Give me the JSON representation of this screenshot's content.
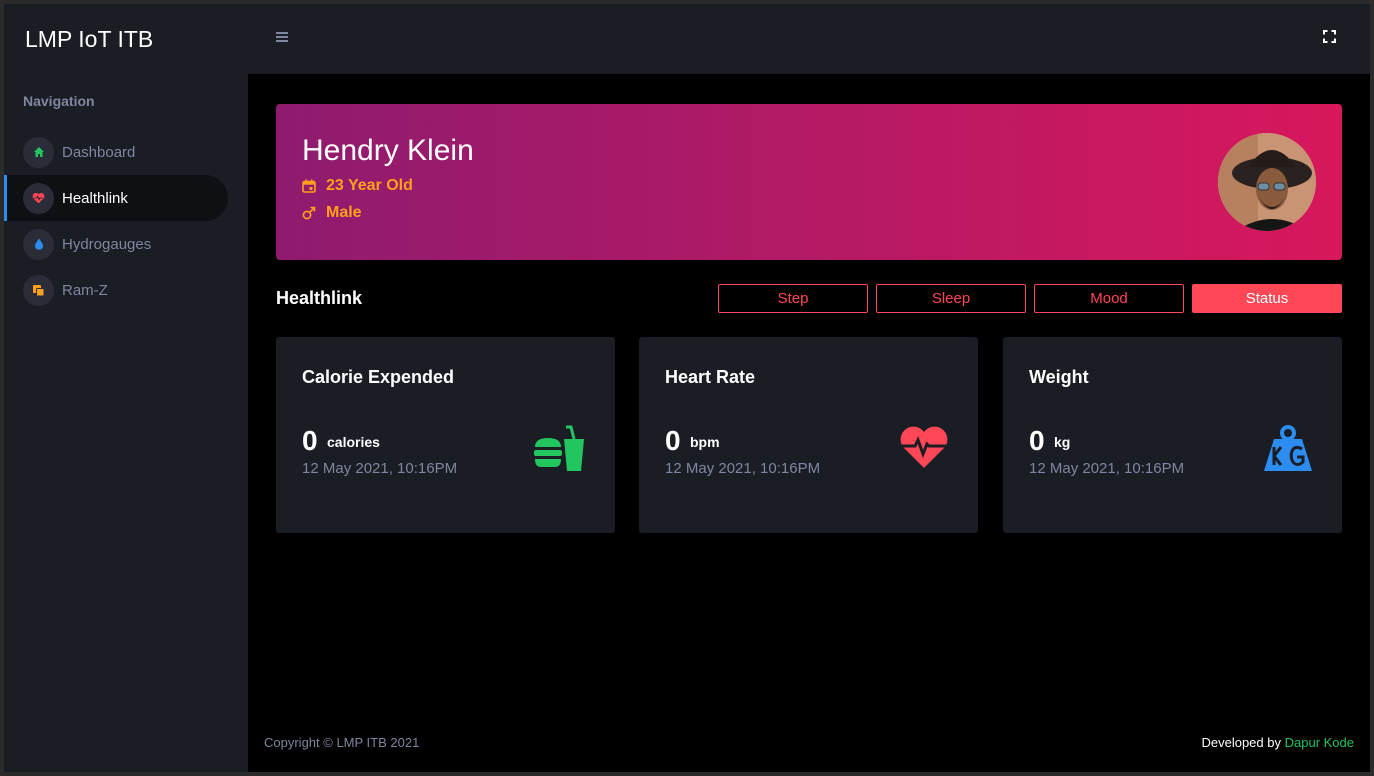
{
  "app": {
    "title": "LMP IoT ITB"
  },
  "sidebar": {
    "heading": "Navigation",
    "items": [
      {
        "label": "Dashboard",
        "icon": "home-icon",
        "active": false
      },
      {
        "label": "Healthlink",
        "icon": "heart-icon",
        "active": true
      },
      {
        "label": "Hydrogauges",
        "icon": "water-drop-icon",
        "active": false
      },
      {
        "label": "Ram-Z",
        "icon": "copy-icon",
        "active": false
      }
    ]
  },
  "topbar": {
    "menu_icon": "hamburger-icon",
    "fullscreen_icon": "fullscreen-icon"
  },
  "profile": {
    "name": "Hendry Klein",
    "age": "23 Year Old",
    "gender": "Male",
    "age_icon": "calendar-icon",
    "gender_icon": "male-icon"
  },
  "section": {
    "title": "Healthlink",
    "tabs": [
      {
        "label": "Step",
        "active": false
      },
      {
        "label": "Sleep",
        "active": false
      },
      {
        "label": "Mood",
        "active": false
      },
      {
        "label": "Status",
        "active": true
      }
    ]
  },
  "cards": [
    {
      "title": "Calorie Expended",
      "value": "0",
      "unit": "calories",
      "time": "12 May 2021, 10:16PM",
      "icon": "burger-drink-icon",
      "color": "#22c55e"
    },
    {
      "title": "Heart Rate",
      "value": "0",
      "unit": "bpm",
      "time": "12 May 2021, 10:16PM",
      "icon": "heartbeat-icon",
      "color": "#ff4755"
    },
    {
      "title": "Weight",
      "value": "0",
      "unit": "kg",
      "time": "12 May 2021, 10:16PM",
      "icon": "weight-kg-icon",
      "color": "#2d8cf0"
    }
  ],
  "footer": {
    "copyright": "Copyright © LMP ITB 2021",
    "developed_by": "Developed by",
    "developer": "Dapur Kode"
  },
  "colors": {
    "accent": "#ff4755",
    "profile_gradient_start": "#8e1b6f",
    "profile_gradient_end": "#d8175c",
    "profile_detail": "#ff9f1a",
    "sidebar_bg": "#1b1d25"
  }
}
